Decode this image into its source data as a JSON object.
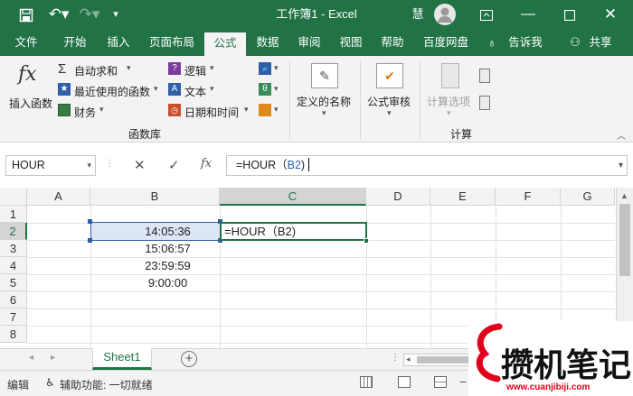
{
  "titlebar": {
    "title": "工作簿1  -  Excel",
    "user": "慧"
  },
  "tabs": [
    "文件",
    "开始",
    "插入",
    "页面布局",
    "公式",
    "数据",
    "审阅",
    "视图",
    "帮助",
    "百度网盘"
  ],
  "tell_me": "告诉我",
  "share": "共享",
  "ribbon": {
    "insert_function": "插入函数",
    "autosum": "自动求和",
    "recent": "最近使用的函数",
    "financial": "财务",
    "logical": "逻辑",
    "text": "文本",
    "datetime": "日期和时间",
    "library_group": "函数库",
    "defined_names": "定义的名称",
    "auditing": "公式审核",
    "calc_options": "计算选项",
    "calc_group": "计算",
    "icon_fx": "fx"
  },
  "formula_bar": {
    "name": "HOUR",
    "fx": "fx",
    "formula_prefix": "=HOUR（",
    "formula_ref": "B2",
    "formula_suffix": ")"
  },
  "columns": [
    "A",
    "B",
    "C",
    "D",
    "E",
    "F",
    "G"
  ],
  "rows": [
    "1",
    "2",
    "3",
    "4",
    "5",
    "6",
    "7",
    "8"
  ],
  "cells": {
    "b2": "14:05:36",
    "b3": "15:06:57",
    "b4": "23:59:59",
    "b5": "9:00:00",
    "c2": "=HOUR（B2)"
  },
  "sheet_tab": "Sheet1",
  "status": {
    "mode": "编辑",
    "accessibility": "辅助功能: 一切就绪"
  },
  "watermark": {
    "brand": "攒机笔记",
    "url": "www.cuanjibiji.com"
  },
  "colors": {
    "excel_green": "#217346",
    "ref_blue": "#2e5ea8",
    "red": "#e0001b"
  }
}
